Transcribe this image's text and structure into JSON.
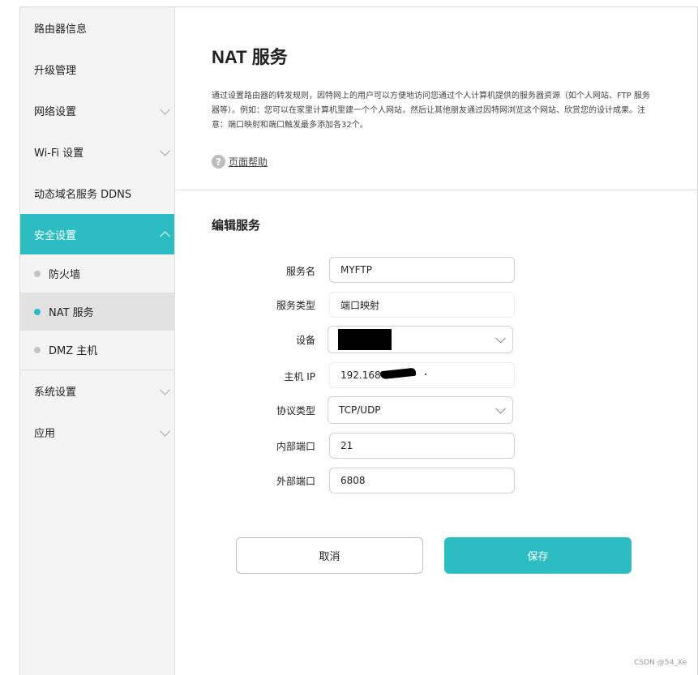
{
  "sidebar": {
    "items": [
      {
        "label": "路由器信息"
      },
      {
        "label": "升级管理"
      },
      {
        "label": "网络设置"
      },
      {
        "label": "Wi-Fi 设置"
      },
      {
        "label": "动态域名服务 DDNS"
      },
      {
        "label": "安全设置"
      },
      {
        "label": "系统设置"
      },
      {
        "label": "应用"
      }
    ],
    "sub_items": [
      {
        "label": "防火墙"
      },
      {
        "label": "NAT 服务"
      },
      {
        "label": "DMZ 主机"
      }
    ]
  },
  "main": {
    "title": "NAT 服务",
    "description": "通过设置路由器的转发规则，因特网上的用户可以方便地访问您通过个人计算机提供的服务器资源（如个人网站、FTP 服务器等）。例如：您可以在家里计算机里建一个个人网站，然后让其他朋友通过因特网浏览这个网站、欣赏您的设计成果。注意：端口映射和端口触发最多添加各32个。",
    "help_label": "页面帮助",
    "section_title": "编辑服务",
    "form": {
      "service_name_label": "服务名",
      "service_name_value": "MYFTP",
      "service_type_label": "服务类型",
      "service_type_value": "端口映射",
      "device_label": "设备",
      "host_ip_label": "主机 IP",
      "host_ip_value": "192.168",
      "protocol_label": "协议类型",
      "protocol_value": "TCP/UDP",
      "internal_port_label": "内部端口",
      "internal_port_value": "21",
      "external_port_label": "外部端口",
      "external_port_value": "6808"
    },
    "buttons": {
      "cancel": "取消",
      "save": "保存"
    }
  },
  "watermark": "CSDN @54_Xe",
  "colors": {
    "accent": "#2bbdc1"
  }
}
